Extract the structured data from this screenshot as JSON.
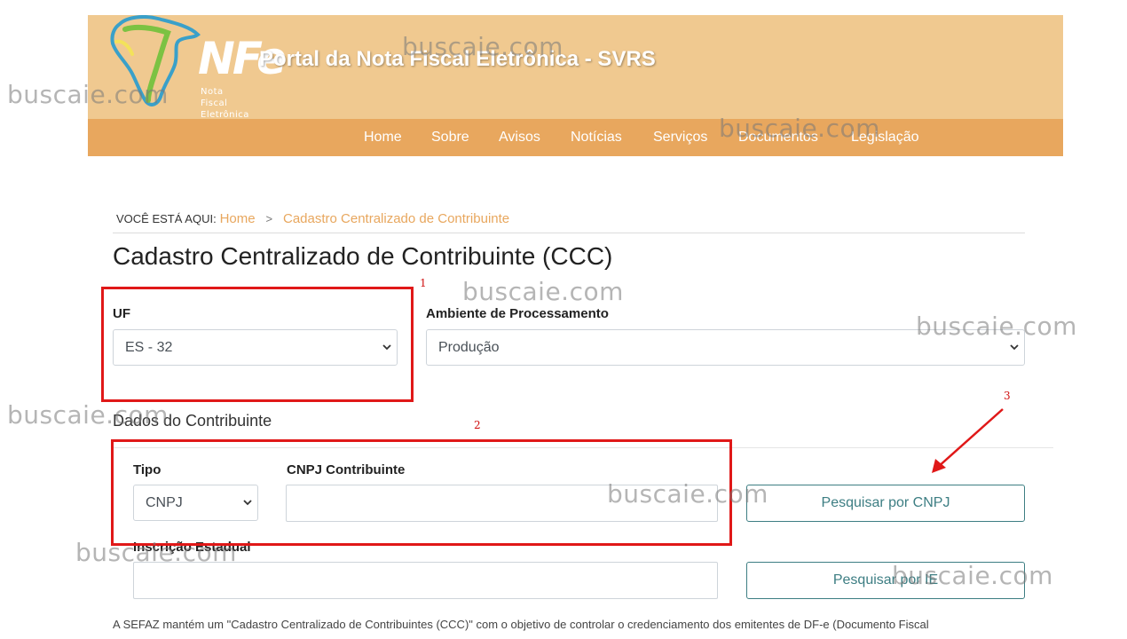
{
  "header": {
    "logo_text": "NFe",
    "logo_subtitle_line1": "Nota Fiscal",
    "logo_subtitle_line2": "Eletrônica",
    "title": "Portal da Nota Fiscal Eletrônica - SVRS",
    "nav": [
      "Home",
      "Sobre",
      "Avisos",
      "Notícias",
      "Serviços",
      "Documentos",
      "Legislação"
    ]
  },
  "breadcrumb": {
    "label": "VOCÊ ESTÁ AQUI:",
    "home": "Home",
    "separator": ">",
    "current": "Cadastro Centralizado de Contribuinte"
  },
  "page": {
    "title": "Cadastro Centralizado de Contribuinte (CCC)"
  },
  "form": {
    "uf_label": "UF",
    "uf_value": "ES - 32",
    "ambiente_label": "Ambiente de Processamento",
    "ambiente_value": "Produção",
    "section_title": "Dados do Contribuinte",
    "tipo_label": "Tipo",
    "tipo_value": "CNPJ",
    "cnpj_label": "CNPJ Contribuinte",
    "cnpj_value": "",
    "ie_label": "Inscrição Estadual",
    "ie_value": "",
    "btn_cnpj": "Pesquisar por CNPJ",
    "btn_ie": "Pesquisar por IE"
  },
  "annotations": {
    "n1": "1",
    "n2": "2",
    "n3": "3",
    "color": "#e01818"
  },
  "bottom_text": "A SEFAZ mantém um \"Cadastro Centralizado de Contribuintes (CCC)\" com o objetivo de controlar o credenciamento dos emitentes de DF-e (Documento Fiscal",
  "watermark": "buscaie.com",
  "colors": {
    "header_bg": "#f0c990",
    "nav_bg": "#e8a75e",
    "accent": "#e8a75e",
    "button": "#3d7e83"
  }
}
